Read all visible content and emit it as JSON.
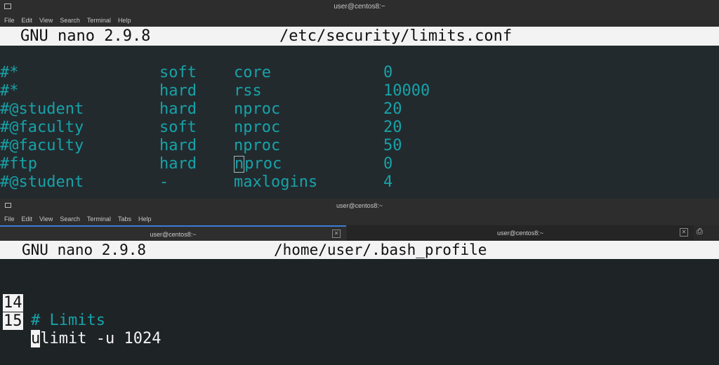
{
  "back_window": {
    "title": "user@centos8:~",
    "menu": [
      "File",
      "Edit",
      "View",
      "Search",
      "Terminal",
      "Help"
    ],
    "nano_version": "GNU nano 2.9.8",
    "file_name": "/etc/security/limits.conf",
    "rows": [
      {
        "domain": "#*",
        "type": "soft",
        "item": "core",
        "value": "0"
      },
      {
        "domain": "#*",
        "type": "hard",
        "item": "rss",
        "value": "10000"
      },
      {
        "domain": "#@student",
        "type": "hard",
        "item": "nproc",
        "value": "20"
      },
      {
        "domain": "#@faculty",
        "type": "soft",
        "item": "nproc",
        "value": "20"
      },
      {
        "domain": "#@faculty",
        "type": "hard",
        "item": "nproc",
        "value": "50"
      },
      {
        "domain": "#ftp",
        "type": "hard",
        "item": "nproc",
        "value": "0"
      },
      {
        "domain": "#@student",
        "type": "-",
        "item": "maxlogins",
        "value": "4"
      }
    ],
    "cursor_char": "n",
    "cursor_rest": "proc",
    "text_color": "#16a3a8"
  },
  "front_window": {
    "title": "user@centos8:~",
    "menu": [
      "File",
      "Edit",
      "View",
      "Search",
      "Terminal",
      "Tabs",
      "Help"
    ],
    "tabs": [
      {
        "label": "user@centos8:~",
        "active": true
      },
      {
        "label": "user@centos8:~",
        "active": false
      }
    ],
    "nano_version": "GNU nano 2.9.8",
    "file_name": "/home/user/.bash_profile",
    "lines": [
      {
        "number": "14",
        "text": "# Limits",
        "color": "#16a3a8"
      },
      {
        "number": "15",
        "cursor_char": "u",
        "text": "limit -u 1024",
        "color": "#f3f3f3"
      }
    ]
  }
}
